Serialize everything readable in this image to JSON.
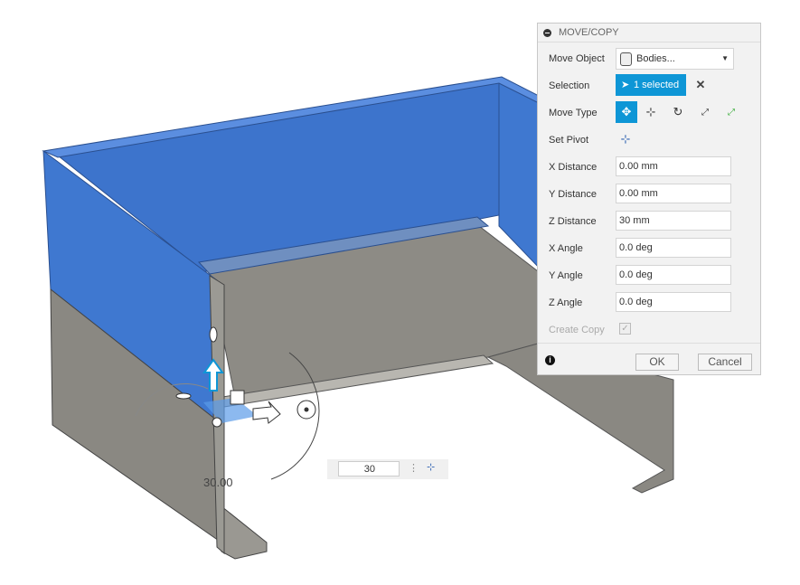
{
  "panel": {
    "title": "MOVE/COPY",
    "move_object_label": "Move Object",
    "move_object_value": "Bodies...",
    "selection_label": "Selection",
    "selection_value": "1 selected",
    "move_type_label": "Move Type",
    "set_pivot_label": "Set Pivot",
    "fields": [
      {
        "label": "X Distance",
        "value": "0.00 mm"
      },
      {
        "label": "Y Distance",
        "value": "0.00 mm"
      },
      {
        "label": "Z Distance",
        "value": "30 mm"
      },
      {
        "label": "X Angle",
        "value": "0.0 deg"
      },
      {
        "label": "Y Angle",
        "value": "0.0 deg"
      },
      {
        "label": "Z Angle",
        "value": "0.0 deg"
      }
    ],
    "create_copy_label": "Create Copy",
    "create_copy_checked": true,
    "ok_label": "OK",
    "cancel_label": "Cancel"
  },
  "viewport": {
    "dimension_label": "30.00",
    "input_value": "30"
  },
  "colors": {
    "selected_body": "#3f78d0",
    "body": "#8a8a82",
    "accent": "#0e96d6"
  }
}
